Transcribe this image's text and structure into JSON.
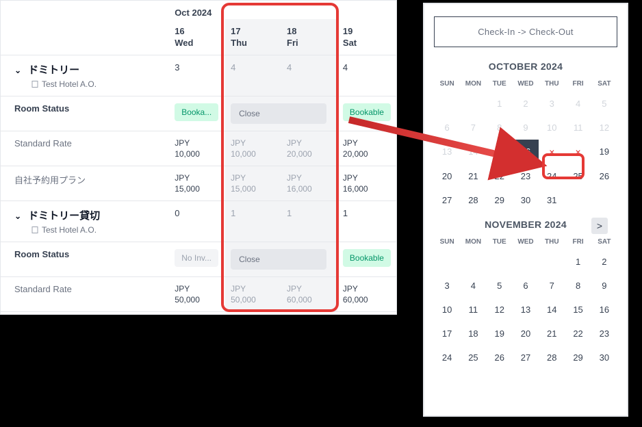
{
  "inventory": {
    "month_label": "Oct 2024",
    "dates": [
      {
        "day": "16",
        "dow": "Wed"
      },
      {
        "day": "17",
        "dow": "Thu"
      },
      {
        "day": "18",
        "dow": "Fri"
      },
      {
        "day": "19",
        "dow": "Sat"
      }
    ],
    "room_types": [
      {
        "name": "ドミトリー",
        "hotel": "Test Hotel A.O.",
        "avail": [
          "3",
          "4",
          "4",
          "4"
        ],
        "status_label": "Room Status",
        "statuses": [
          "Booka...",
          "Close",
          "Bookable"
        ],
        "rates": [
          {
            "label": "Standard Rate",
            "cur": "JPY",
            "values": [
              "10,000",
              "10,000",
              "20,000",
              "20,000"
            ]
          },
          {
            "label": "自社予約用プラン",
            "cur": "JPY",
            "values": [
              "15,000",
              "15,000",
              "16,000",
              "16,000"
            ]
          }
        ]
      },
      {
        "name": "ドミトリー貸切",
        "hotel": "Test Hotel A.O.",
        "avail": [
          "0",
          "1",
          "1",
          "1"
        ],
        "status_label": "Room Status",
        "statuses": [
          "No Inv...",
          "Close",
          "Bookable"
        ],
        "rates": [
          {
            "label": "Standard Rate",
            "cur": "JPY",
            "values": [
              "50,000",
              "50,000",
              "60,000",
              "60,000"
            ]
          }
        ]
      }
    ]
  },
  "calendar": {
    "header": "Check-In -> Check-Out",
    "next_label": ">",
    "dow": [
      "SUN",
      "MON",
      "TUE",
      "WED",
      "THU",
      "FRI",
      "SAT"
    ],
    "months": [
      {
        "title": "OCTOBER 2024",
        "weeks": [
          [
            null,
            null,
            {
              "d": "1",
              "m": true
            },
            {
              "d": "2",
              "m": true
            },
            {
              "d": "3",
              "m": true
            },
            {
              "d": "4",
              "m": true
            },
            {
              "d": "5",
              "m": true
            }
          ],
          [
            {
              "d": "6",
              "m": true
            },
            {
              "d": "7",
              "m": true
            },
            {
              "d": "8",
              "m": true
            },
            {
              "d": "9",
              "m": true
            },
            {
              "d": "10",
              "m": true
            },
            {
              "d": "11",
              "m": true
            },
            {
              "d": "12",
              "m": true
            }
          ],
          [
            {
              "d": "13",
              "m": true
            },
            {
              "d": "14",
              "m": true
            },
            {
              "d": "15",
              "m": true
            },
            {
              "d": "16",
              "sel": true
            },
            {
              "d": "×",
              "cl": true
            },
            {
              "d": "×",
              "cl": true
            },
            {
              "d": "19"
            }
          ],
          [
            {
              "d": "20"
            },
            {
              "d": "21"
            },
            {
              "d": "22"
            },
            {
              "d": "23"
            },
            {
              "d": "24"
            },
            {
              "d": "25"
            },
            {
              "d": "26"
            }
          ],
          [
            {
              "d": "27"
            },
            {
              "d": "28"
            },
            {
              "d": "29"
            },
            {
              "d": "30"
            },
            {
              "d": "31"
            },
            null,
            null
          ]
        ]
      },
      {
        "title": "NOVEMBER 2024",
        "has_next": true,
        "weeks": [
          [
            null,
            null,
            null,
            null,
            null,
            {
              "d": "1"
            },
            {
              "d": "2"
            }
          ],
          [
            {
              "d": "3"
            },
            {
              "d": "4"
            },
            {
              "d": "5"
            },
            {
              "d": "6"
            },
            {
              "d": "7"
            },
            {
              "d": "8"
            },
            {
              "d": "9"
            }
          ],
          [
            {
              "d": "10"
            },
            {
              "d": "11"
            },
            {
              "d": "12"
            },
            {
              "d": "13"
            },
            {
              "d": "14"
            },
            {
              "d": "15"
            },
            {
              "d": "16"
            }
          ],
          [
            {
              "d": "17"
            },
            {
              "d": "18"
            },
            {
              "d": "19"
            },
            {
              "d": "20"
            },
            {
              "d": "21"
            },
            {
              "d": "22"
            },
            {
              "d": "23"
            }
          ],
          [
            {
              "d": "24"
            },
            {
              "d": "25"
            },
            {
              "d": "26"
            },
            {
              "d": "27"
            },
            {
              "d": "28"
            },
            {
              "d": "29"
            },
            {
              "d": "30"
            }
          ]
        ]
      }
    ]
  }
}
